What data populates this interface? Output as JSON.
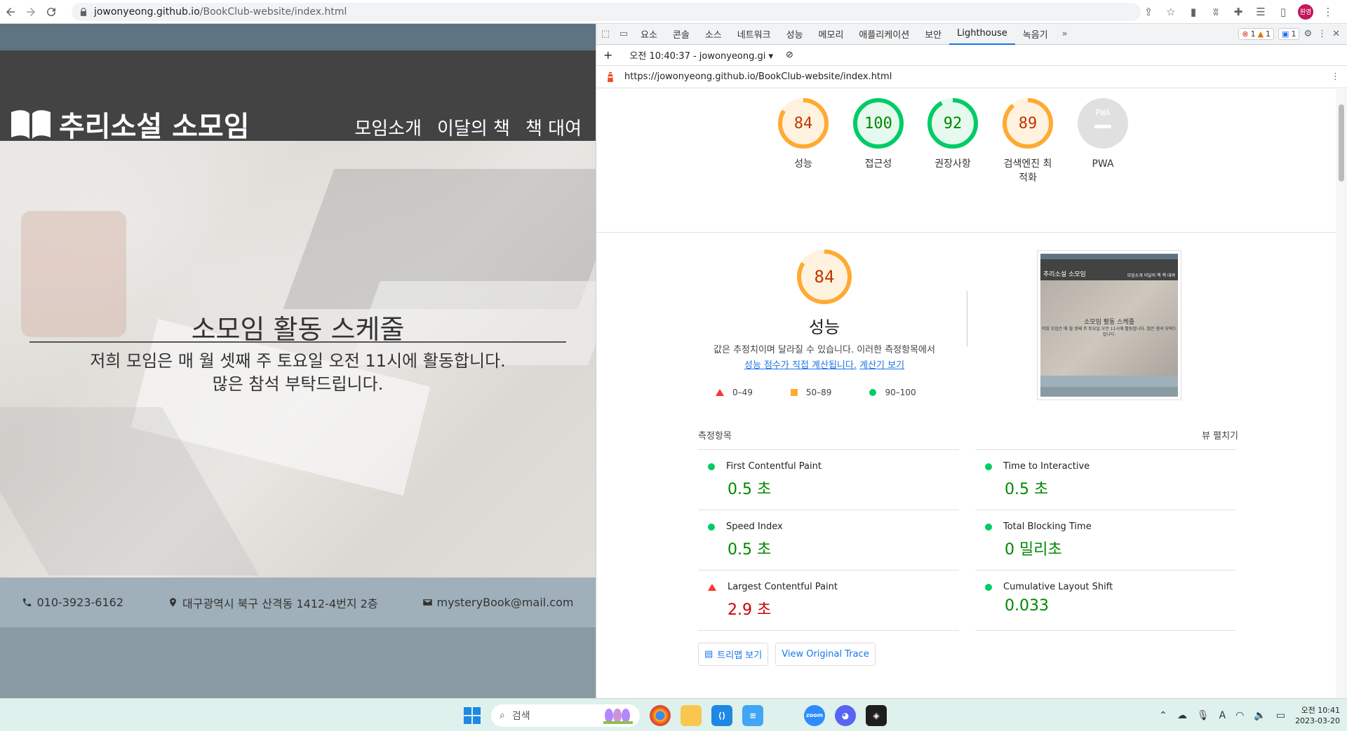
{
  "browser": {
    "url_host": "jowonyeong.github.io",
    "url_path": "/BookClub-website/index.html",
    "profile_label": "원영"
  },
  "site": {
    "logo_text": "추리소설 소모임",
    "nav": [
      "모임소개",
      "이달의 책",
      "책 대여"
    ],
    "hero_title": "소모임 활동 스케줄",
    "hero_line1": "저희 모임은 매 월 셋째 주 토요일 오전 11시에 활동합니다.",
    "hero_line2": "많은 참석 부탁드립니다.",
    "footer": {
      "phone": "010-3923-6162",
      "address": "대구광역시 북구 산격동 1412-4번지 2층",
      "email": "mysteryBook@mail.com"
    }
  },
  "devtools": {
    "tabs": [
      "요소",
      "콘솔",
      "소스",
      "네트워크",
      "성능",
      "메모리",
      "애플리케이션",
      "보안",
      "Lighthouse",
      "녹음기"
    ],
    "active_tab": "Lighthouse",
    "badges": {
      "errors": "1",
      "warnings": "1",
      "messages": "1"
    },
    "report_selector": "오전 10:40:37 - jowonyeong.gi",
    "report_url": "https://jowonyeong.github.io/BookClub-website/index.html",
    "gauges": [
      {
        "label": "성능",
        "score": "84",
        "value": 84
      },
      {
        "label": "접근성",
        "score": "100",
        "value": 100
      },
      {
        "label": "권장사항",
        "score": "92",
        "value": 92
      },
      {
        "label": "검색엔진 최적화",
        "score": "89",
        "value": 89
      },
      {
        "label": "PWA",
        "score": "",
        "value": 0
      }
    ],
    "pwa_badge": "PWA",
    "performance": {
      "score": "84",
      "title": "성능",
      "desc_line1": "값은 추정치이며 달라질 수 있습니다. 이러한 측정항목에서",
      "link1": "성능 점수가 직접 계산됩니다.",
      "link2": "계산기 보기",
      "legend": [
        "0–49",
        "50–89",
        "90–100"
      ]
    },
    "thumbnail": {
      "logo": "추리소설 소모임",
      "nav": "모임소개 이달의 책 책 대여",
      "title": "소모임 활동 스케줄",
      "text": "저희 모임은 매 월 셋째 주 토요일 오전 11시에 활동합니다. 많은 참석 부탁드립니다."
    },
    "metrics_header": "측정항목",
    "expand_view": "뷰 펼치기",
    "metrics": [
      {
        "name": "First Contentful Paint",
        "value": "0.5 초",
        "status": "good"
      },
      {
        "name": "Time to Interactive",
        "value": "0.5 초",
        "status": "good"
      },
      {
        "name": "Speed Index",
        "value": "0.5 초",
        "status": "good"
      },
      {
        "name": "Total Blocking Time",
        "value": "0 밀리초",
        "status": "good"
      },
      {
        "name": "Largest Contentful Paint",
        "value": "2.9 초",
        "status": "poor"
      },
      {
        "name": "Cumulative Layout Shift",
        "value": "0.033",
        "status": "good"
      }
    ],
    "buttons": [
      "트리맵 보기",
      "View Original Trace"
    ]
  },
  "taskbar": {
    "search_placeholder": "검색",
    "clock_time": "오전 10:41",
    "clock_date": "2023-03-20",
    "ime": "A"
  },
  "colors": {
    "orange": "#fa3",
    "green": "#0c6",
    "red": "#f33",
    "site_header": "#434343",
    "accent_blue": "#1a73e8"
  }
}
